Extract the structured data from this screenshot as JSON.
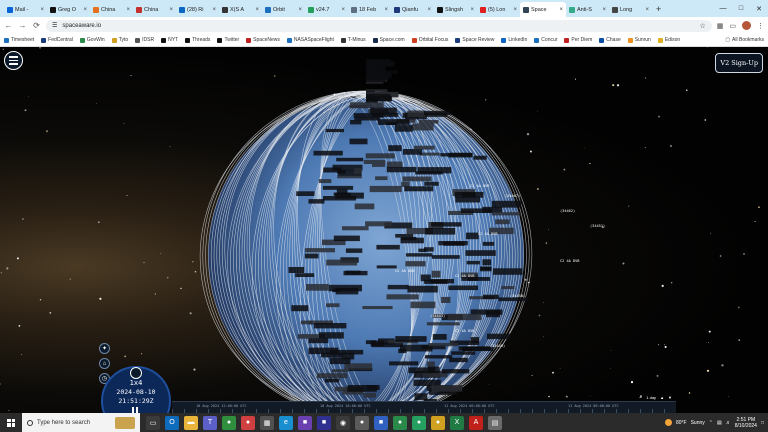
{
  "browser": {
    "tabs": [
      {
        "label": "Mail -",
        "color": "#0a64d8"
      },
      {
        "label": "Greg O",
        "color": "#111111"
      },
      {
        "label": "China",
        "color": "#e5701f"
      },
      {
        "label": "China",
        "color": "#c4302b"
      },
      {
        "label": "(28) Ri",
        "color": "#0a66c2"
      },
      {
        "label": "X(S A",
        "color": "#333333"
      },
      {
        "label": "Orbit",
        "color": "#1d6fbf"
      },
      {
        "label": "v24.7",
        "color": "#22a05a"
      },
      {
        "label": "18 Feb",
        "color": "#607080"
      },
      {
        "label": "Qianfu",
        "color": "#1e3a7a"
      },
      {
        "label": "Slingsh",
        "color": "#111111"
      },
      {
        "label": "(5) Lon",
        "color": "#e02020"
      },
      {
        "label": "Space",
        "color": "#334455",
        "active": true
      },
      {
        "label": "Anti-S",
        "color": "#33aa88"
      },
      {
        "label": "Long",
        "color": "#444444"
      }
    ],
    "new_tab_glyph": "+",
    "url": "spaceaware.io",
    "bookmarks": [
      {
        "label": "Timesheet",
        "color": "#1d6fbf"
      },
      {
        "label": "FedCentral",
        "color": "#1a3c7a"
      },
      {
        "label": "GovWin",
        "color": "#2a8a4a"
      },
      {
        "label": "Tyto",
        "color": "#d0a020"
      },
      {
        "label": "IDSR",
        "color": "#555555"
      },
      {
        "label": "NYT",
        "color": "#111111"
      },
      {
        "label": "Threads",
        "color": "#111111"
      },
      {
        "label": "Twitter",
        "color": "#111111"
      },
      {
        "label": "SpaceNews",
        "color": "#c02020"
      },
      {
        "label": "NASASpaceFlight",
        "color": "#1d6fbf"
      },
      {
        "label": "T-Minus",
        "color": "#333333"
      },
      {
        "label": "Space.com",
        "color": "#1a2a4a"
      },
      {
        "label": "Orbital Focus",
        "color": "#d04020"
      },
      {
        "label": "Space Review",
        "color": "#1a3c7a"
      },
      {
        "label": "LinkedIn",
        "color": "#0a66c2"
      },
      {
        "label": "Concur",
        "color": "#1d6fbf"
      },
      {
        "label": "Per Diem",
        "color": "#c02020"
      },
      {
        "label": "Chase",
        "color": "#0a4ea8"
      },
      {
        "label": "Sunrun",
        "color": "#f09020"
      },
      {
        "label": "Edison",
        "color": "#e0b020"
      }
    ],
    "all_bookmarks": "All Bookmarks"
  },
  "app": {
    "v2_signup": "V2 Sign-Up",
    "speed": "1x4",
    "date": "2024-08-10",
    "time": "21:51:29Z",
    "timeline_labels": [
      "10 Aug 2024 12:00:00 UTC",
      "10 Aug 2024 18:00:00 UTC",
      "11 Aug 2024 00:00:00 UTC",
      "11 Aug 2024 06:00:00 UTC"
    ],
    "timeline_scale": "1 day",
    "sat_labels": [
      "C2 4A DVB",
      "(34467)",
      "C2 4A DVB",
      "(34462)",
      "C2 4A DVB",
      "(34458)",
      "C2 4A DVB",
      "(34451)",
      "C2 4A DVB",
      "(34449)",
      "C2 4A DVB",
      "(34443)"
    ]
  },
  "taskbar": {
    "search_placeholder": "Type here to search",
    "weather_temp": "80°F",
    "weather_desc": "Sunny",
    "time": "2:51 PM",
    "date": "8/10/2024",
    "apps": [
      {
        "name": "task-view",
        "color": "#3a3a3a",
        "glyph": "▭"
      },
      {
        "name": "outlook",
        "color": "#0f6cbd",
        "glyph": "O"
      },
      {
        "name": "file-explorer",
        "color": "#e8b43a",
        "glyph": "▬"
      },
      {
        "name": "teams",
        "color": "#5b5fc7",
        "glyph": "T"
      },
      {
        "name": "chrome",
        "color": "#2f8f3f",
        "glyph": "●"
      },
      {
        "name": "app-6",
        "color": "#d04040",
        "glyph": "●"
      },
      {
        "name": "calculator",
        "color": "#505050",
        "glyph": "▦"
      },
      {
        "name": "edge",
        "color": "#1a8fd0",
        "glyph": "e"
      },
      {
        "name": "app-9",
        "color": "#6a40b0",
        "glyph": "■"
      },
      {
        "name": "app-10",
        "color": "#303090",
        "glyph": "■"
      },
      {
        "name": "app-11",
        "color": "#3a3a3a",
        "glyph": "◉"
      },
      {
        "name": "app-12",
        "color": "#5a5a5a",
        "glyph": "●"
      },
      {
        "name": "app-13",
        "color": "#3060c0",
        "glyph": "■"
      },
      {
        "name": "app-14",
        "color": "#2a8a4a",
        "glyph": "●"
      },
      {
        "name": "whatsapp",
        "color": "#25a060",
        "glyph": "●"
      },
      {
        "name": "chrome-2",
        "color": "#d0a020",
        "glyph": "●"
      },
      {
        "name": "excel",
        "color": "#1f7a44",
        "glyph": "X"
      },
      {
        "name": "acrobat",
        "color": "#c0201a",
        "glyph": "A"
      },
      {
        "name": "notepad",
        "color": "#6a6a6a",
        "glyph": "▤"
      }
    ]
  }
}
